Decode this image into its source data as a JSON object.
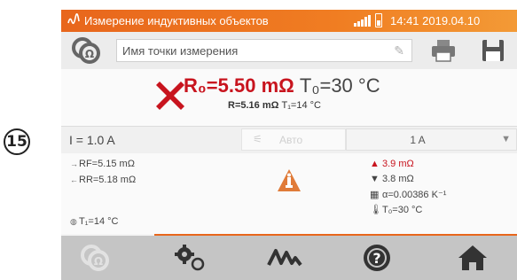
{
  "step_badge": "15",
  "titlebar": {
    "title": "Измерение индуктивных объектов",
    "datetime": "14:41 2019.04.10",
    "icons": [
      "meter-logo-icon",
      "signal-icon",
      "battery-icon"
    ]
  },
  "point": {
    "placeholder": "Имя точки измерения",
    "icons": [
      "measurement-point-icon",
      "pencil-icon",
      "printer-icon",
      "save-icon"
    ]
  },
  "result": {
    "status": "fail",
    "main_value": "R₀=5.50 mΩ",
    "main_temp": "T₀=30 °C",
    "sub_value": "R=5.16 mΩ",
    "sub_temp": "T₁=14 °C"
  },
  "settings": {
    "current": "I = 1.0 A",
    "auto_label": "Авто",
    "range_value": "1 A"
  },
  "details": {
    "rf": "R<sub>F</sub>=5.15 mΩ",
    "rf_text": "RF=5.15 mΩ",
    "rr_text": "RR=5.18 mΩ",
    "t1": "T₁=14 °C",
    "limit_upper": "3.9 mΩ",
    "limit_lower": "3.8 mΩ",
    "alpha": "α=0.00386 K⁻¹",
    "t0": "T₀=30 °C"
  },
  "colors": {
    "accent": "#e8661c",
    "fail": "#c8141e",
    "warning": "#e07b39",
    "bottom_bar": "#c5c5c5"
  },
  "bottom_nav": [
    "ohm-meter-icon",
    "settings-gears-icon",
    "waveform-icon",
    "help-icon",
    "home-icon"
  ]
}
